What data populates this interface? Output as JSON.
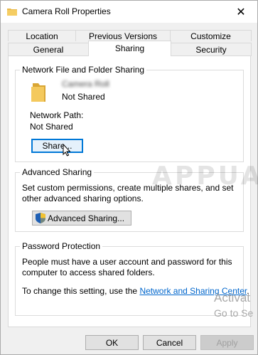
{
  "window": {
    "title": "Camera Roll Properties",
    "close_glyph": "✕"
  },
  "tabs_row1": [
    {
      "label": "Location"
    },
    {
      "label": "Previous Versions"
    },
    {
      "label": "Customize"
    }
  ],
  "tabs_row2": [
    {
      "label": "General"
    },
    {
      "label": "Sharing",
      "active": true
    },
    {
      "label": "Security"
    }
  ],
  "network_sharing": {
    "legend": "Network File and Folder Sharing",
    "folder_name": "Camera Roll",
    "status": "Not Shared",
    "path_label": "Network Path:",
    "path_value": "Not Shared",
    "share_button": "Share..."
  },
  "advanced_sharing": {
    "legend": "Advanced Sharing",
    "description": "Set custom permissions, create multiple shares, and set other advanced sharing options.",
    "button": "Advanced Sharing..."
  },
  "password_protection": {
    "legend": "Password Protection",
    "description": "People must have a user account and password for this computer to access shared folders.",
    "change_text": "To change this setting, use the ",
    "link": "Network and Sharing Center",
    "link_suffix": "."
  },
  "footer": {
    "ok": "OK",
    "cancel": "Cancel",
    "apply": "Apply"
  },
  "overlay": {
    "watermark": "APPUALS",
    "activate_line1": "Activat",
    "activate_line2": "Go to Se"
  },
  "colors": {
    "accent": "#0078d7",
    "link": "#0066cc",
    "folder": "#e8b84a"
  },
  "icons": [
    "folder-icon",
    "shield-icon",
    "cursor-icon",
    "close-icon"
  ]
}
